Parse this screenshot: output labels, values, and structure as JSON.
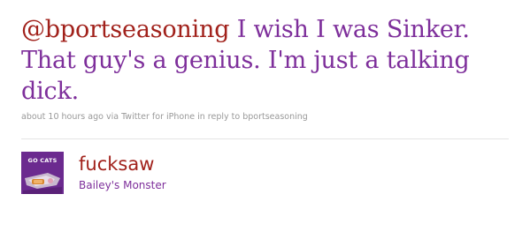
{
  "tweet": {
    "mention": "@bportseasoning",
    "body": " I wish I was Sinker. That guy's a genius. I'm just a talking dick.",
    "meta": {
      "time": "about 10 hours ago",
      "via_prefix": " via ",
      "source": "Twitter for iPhone",
      "reply_prefix": " in reply to ",
      "reply_to": "bportseasoning"
    }
  },
  "author": {
    "screen_name": "fucksaw",
    "full_name": "Bailey's Monster",
    "avatar_text": "GO CATS"
  },
  "colors": {
    "link": "#a1211b",
    "text": "#7e2f9b",
    "meta": "#999999",
    "avatar_bg": "#6b2a8f"
  }
}
